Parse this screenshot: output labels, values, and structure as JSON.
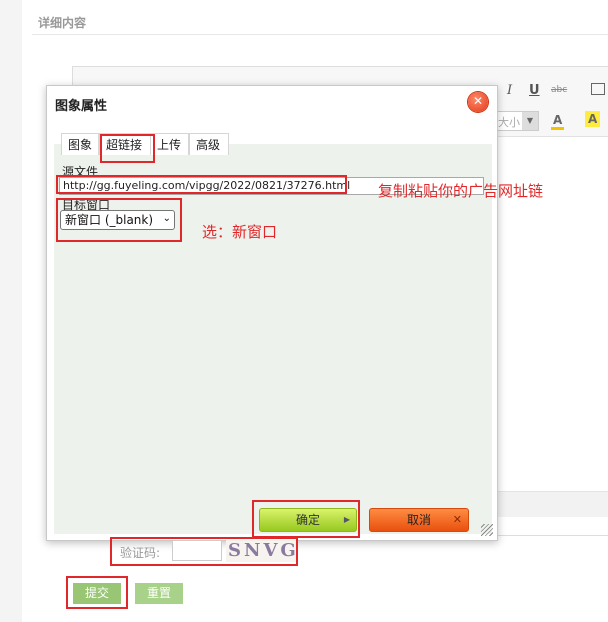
{
  "section": {
    "title": "详细内容"
  },
  "editor": {
    "toolbar": {
      "italic": "I",
      "underline": "U",
      "strike": "abc",
      "font_size_value": "大小",
      "font_color_glyph": "A",
      "bg_color_glyph": "A",
      "dropdown_arrow": "▼"
    }
  },
  "dialog": {
    "title": "图象属性",
    "close_glyph": "✕",
    "tabs": [
      {
        "label": "图象"
      },
      {
        "label": "超链接"
      },
      {
        "label": "上传"
      },
      {
        "label": "高级"
      }
    ],
    "active_tab": "超链接",
    "source_label": "源文件",
    "source_value": "http://gg.fuyeling.com/vipgg/2022/0821/37276.html",
    "target_label": "目标窗口",
    "target_value": "新窗口 (_blank)",
    "select_arrow": "⌄",
    "ok_label": "确定",
    "ok_arrow": "▶",
    "cancel_label": "取消",
    "cancel_mark": "✕"
  },
  "form": {
    "captcha_label": "验证码:",
    "captcha_text": "SNVG",
    "submit_label": "提交",
    "reset_label": "重置"
  },
  "annotations": {
    "note_url": "复制粘贴你的广告网址链",
    "note_target": "选：新窗口",
    "highlight_color": "#e0282a"
  }
}
